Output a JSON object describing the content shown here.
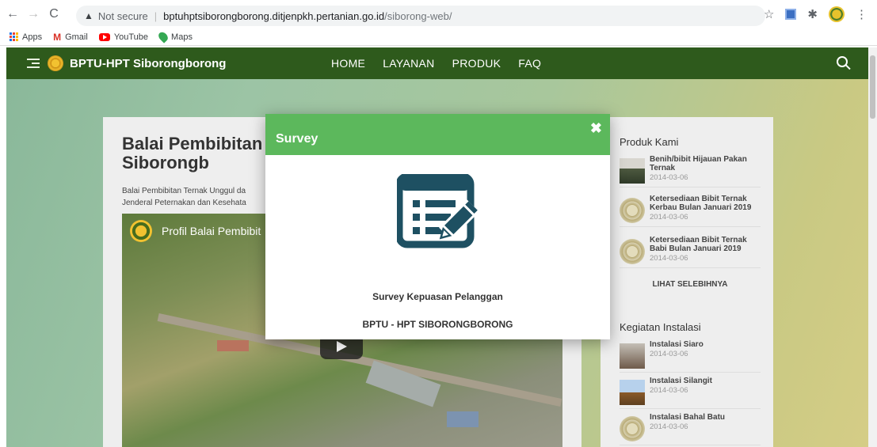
{
  "browser": {
    "security_label": "Not secure",
    "url_domain": "bptuhptsiborongborong.ditjenpkh.pertanian.go.id",
    "url_path": "/siborong-web/",
    "bookmarks": [
      {
        "label": "Apps",
        "icon": "apps-icon"
      },
      {
        "label": "Gmail",
        "icon": "gmail-icon"
      },
      {
        "label": "YouTube",
        "icon": "youtube-icon"
      },
      {
        "label": "Maps",
        "icon": "maps-icon"
      }
    ]
  },
  "site": {
    "title": "BPTU-HPT Siborongborong",
    "menu": [
      "HOME",
      "LAYANAN",
      "PRODUK",
      "FAQ"
    ],
    "nav_color": "#2e5a1c"
  },
  "main": {
    "heading": "Balai Pembibitan Ternak Siborongb",
    "description": "Balai Pembibitan Ternak Unggul da Jenderal Peternakan dan Kesehata",
    "video_title": "Profil Balai Pembibit"
  },
  "sidebar": {
    "products_heading": "Produk Kami",
    "products": [
      {
        "title": "Benih/bibit Hijauan Pakan Ternak",
        "date": "2014-03-06"
      },
      {
        "title": "Ketersediaan Bibit Ternak Kerbau Bulan Januari 2019",
        "date": "2014-03-06"
      },
      {
        "title": "Ketersediaan Bibit Ternak Babi Bulan Januari 2019",
        "date": "2014-03-06"
      }
    ],
    "see_more": "LIHAT SELEBIHNYA",
    "activities_heading": "Kegiatan Instalasi",
    "activities": [
      {
        "title": "Instalasi Siaro",
        "date": "2014-03-06"
      },
      {
        "title": "Instalasi Silangit",
        "date": "2014-03-06"
      },
      {
        "title": "Instalasi Bahal Batu",
        "date": "2014-03-06"
      }
    ]
  },
  "modal": {
    "title": "Survey",
    "close_glyph": "✖",
    "icon": "survey-clipboard-icon",
    "icon_color": "#1e5062",
    "header_color": "#5cb85c",
    "line1": "Survey Kepuasan Pelanggan",
    "line2": "BPTU - HPT SIBORONGBORONG"
  }
}
